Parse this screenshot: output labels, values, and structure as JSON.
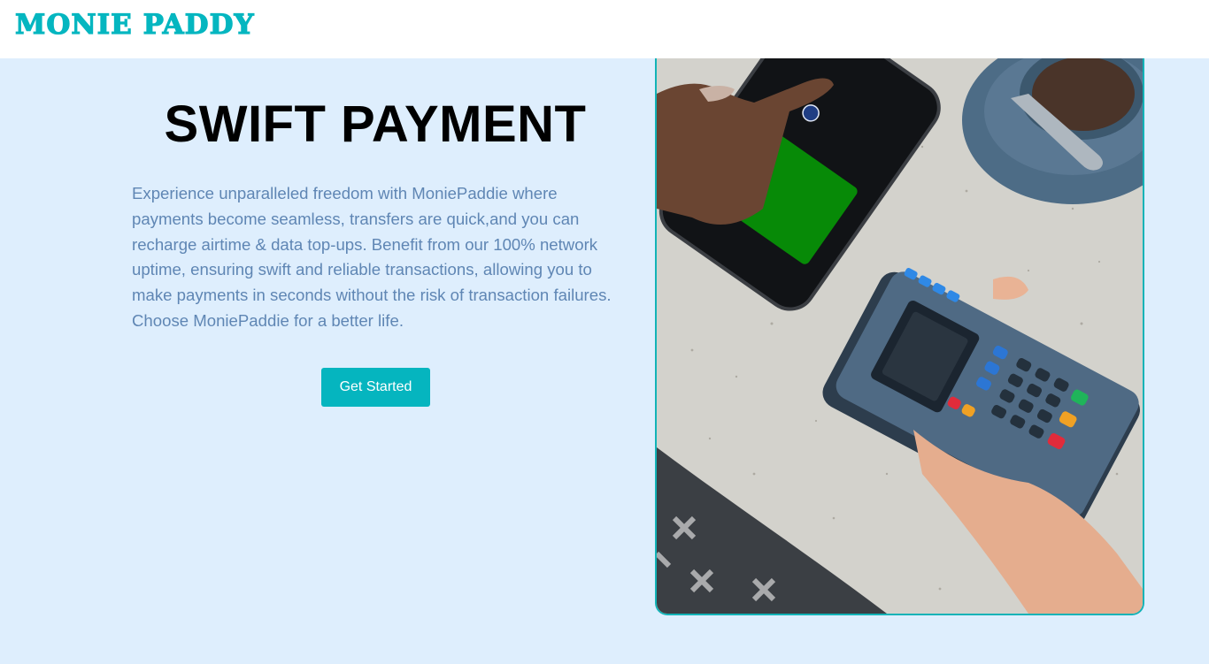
{
  "header": {
    "logo_text": "MONIE PADDY"
  },
  "hero": {
    "title": "SWIFT PAYMENT",
    "description": "Experience unparalleled freedom with MoniePaddie where payments become seamless, transfers are quick,and you can recharge airtime & data top-ups. Benefit from our 100% network uptime, ensuring swift and reliable transactions, allowing you to make payments in seconds without the risk of transaction failures. Choose MoniePaddie for a better life.",
    "cta_label": "Get Started"
  },
  "image": {
    "alt": "Hand tapping a phone on a card payment terminal",
    "icon": "contactless-payment-photo"
  },
  "colors": {
    "brand": "#05b6c0",
    "page_background": "#deeefd",
    "body_text": "#5f86b4",
    "phone_screen": "#078a07"
  }
}
